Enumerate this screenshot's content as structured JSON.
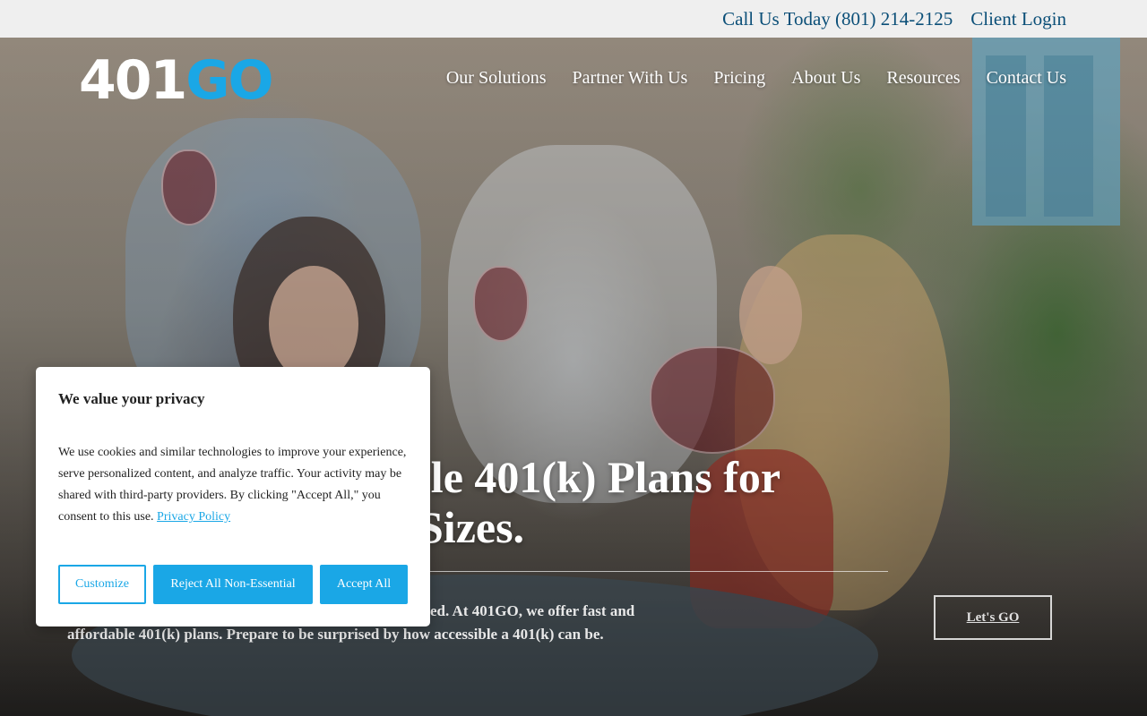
{
  "topbar": {
    "phone": "Call Us Today (801) 214-2125",
    "client_login": "Client Login"
  },
  "logo": {
    "part1": "401",
    "part2": "GO"
  },
  "nav": {
    "items": [
      {
        "label": "Our Solutions"
      },
      {
        "label": "Partner With Us"
      },
      {
        "label": "Pricing"
      },
      {
        "label": "About Us"
      },
      {
        "label": "Resources"
      },
      {
        "label": "Contact Us"
      }
    ]
  },
  "hero": {
    "headline_line1": "ble 401(k) Plans for",
    "headline_line2": "Sizes.",
    "subtext_line1": "ed. At 401GO, we offer fast and",
    "subtext_line2": "affordable 401(k) plans. Prepare to be surprised by how accessible a 401(k) can be.",
    "cta_label": "Let's GO"
  },
  "cookie_banner": {
    "title": "We value your privacy",
    "body": "We use cookies and similar technologies to improve your experience, serve personalized content, and analyze traffic. Your activity may be shared with third-party providers. By clicking \"Accept All,\" you consent to this use.",
    "privacy_link": "Privacy Policy",
    "customize_label": "Customize",
    "reject_label": "Reject All Non-Essential",
    "accept_label": "Accept All"
  },
  "colors": {
    "brand_blue": "#1aa7e6",
    "topbar_text": "#0b4f78",
    "topbar_bg": "#efefef"
  }
}
